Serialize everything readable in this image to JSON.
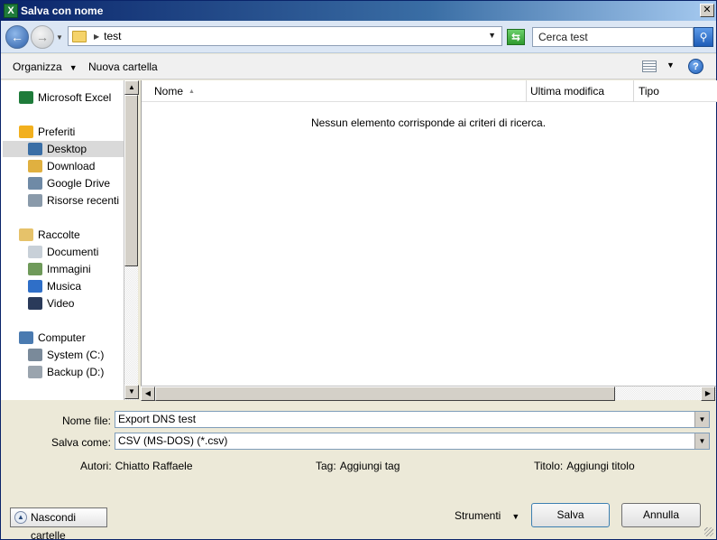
{
  "window": {
    "title": "Salva con nome",
    "app_icon_letter": "X",
    "close_glyph": "✕"
  },
  "nav": {
    "back_glyph": "←",
    "forward_glyph": "→",
    "address": "test",
    "search_placeholder": "Cerca test",
    "refresh_glyph": "⇆",
    "search_glyph": "⚲"
  },
  "toolbar": {
    "organize_label": "Organizza",
    "new_folder_label": "Nuova cartella",
    "help_glyph": "?"
  },
  "sidebar": {
    "items": [
      {
        "label": "Microsoft Excel",
        "icon": "excel-icon",
        "color": "#1e7b3a"
      },
      {
        "label": "Preferiti",
        "icon": "star-icon",
        "color": "#f2b01e"
      },
      {
        "label": "Desktop",
        "icon": "desktop-icon",
        "color": "#3a6ea5",
        "selected": true
      },
      {
        "label": "Download",
        "icon": "download-folder-icon",
        "color": "#e0b040"
      },
      {
        "label": "Google Drive",
        "icon": "google-drive-icon",
        "color": "#6f8aa6"
      },
      {
        "label": "Risorse recenti",
        "icon": "recent-places-icon",
        "color": "#8a9aaa"
      },
      {
        "label": "Raccolte",
        "icon": "libraries-icon",
        "color": "#e6c26a"
      },
      {
        "label": "Documenti",
        "icon": "documents-icon",
        "color": "#c8d0d8"
      },
      {
        "label": "Immagini",
        "icon": "pictures-icon",
        "color": "#6f9a5a"
      },
      {
        "label": "Musica",
        "icon": "music-icon",
        "color": "#2f6fc8"
      },
      {
        "label": "Video",
        "icon": "video-icon",
        "color": "#2a3a5a"
      },
      {
        "label": "Computer",
        "icon": "computer-icon",
        "color": "#4a7ab0"
      },
      {
        "label": "System (C:)",
        "icon": "drive-c-icon",
        "color": "#7a8a9a"
      },
      {
        "label": "Backup (D:)",
        "icon": "drive-d-icon",
        "color": "#9aa4ae"
      }
    ]
  },
  "filelist": {
    "columns": [
      "Nome",
      "Ultima modifica",
      "Tipo"
    ],
    "empty_message": "Nessun elemento corrisponde ai criteri di ricerca."
  },
  "form": {
    "filename_label": "Nome file:",
    "filename_value": "Export DNS test",
    "savetype_label": "Salva come:",
    "savetype_value": "CSV (MS-DOS) (*.csv)",
    "authors_label": "Autori:",
    "authors_value": "Chiatto Raffaele",
    "tags_label": "Tag:",
    "tags_value": "Aggiungi tag",
    "title_label": "Titolo:",
    "title_value": "Aggiungi titolo"
  },
  "footer": {
    "hide_folders_label": "Nascondi cartelle",
    "tools_label": "Strumenti",
    "save_label": "Salva",
    "cancel_label": "Annulla"
  }
}
